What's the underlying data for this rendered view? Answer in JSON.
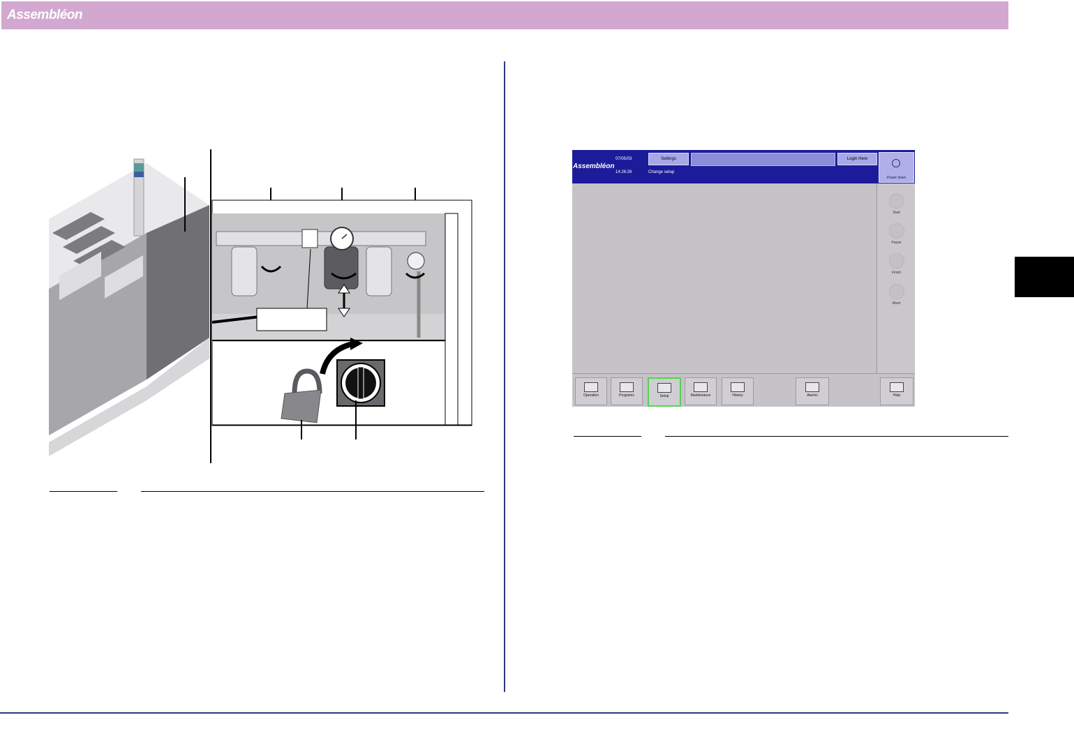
{
  "brand": {
    "logo": "Assembléon"
  },
  "screen": {
    "logo": "Assembléon",
    "date": "07/05/03",
    "time": "14:26:26",
    "settings_label": "Settings",
    "login_label": "Login Here",
    "subtitle": "Change setup",
    "power_label": "Power down",
    "side_buttons": [
      "Start",
      "Pause",
      "Finish",
      "Abort"
    ],
    "tabs": [
      "Operation",
      "Programs",
      "Setup",
      "Maintenance",
      "History",
      "Alarms",
      "Help"
    ],
    "active_tab": "Setup"
  },
  "colors": {
    "header_band": "#d2a8d0",
    "rule": "#2a3b7d",
    "screen_bar": "#1c1c9a",
    "active_tab_border": "#52d452"
  }
}
